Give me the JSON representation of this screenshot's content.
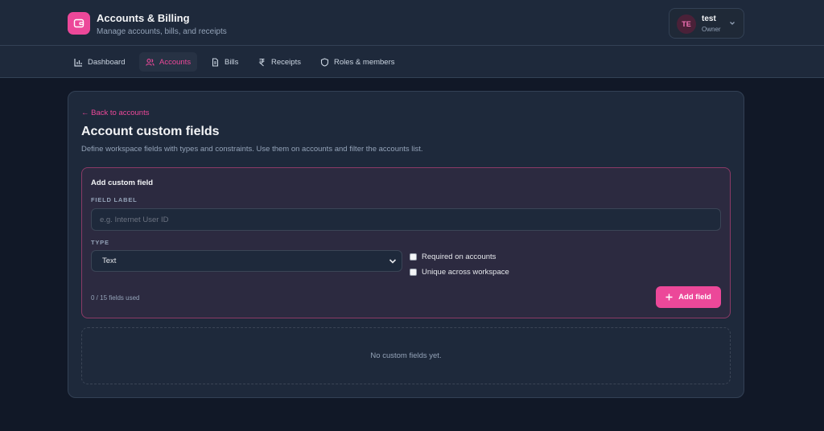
{
  "app": {
    "title": "Accounts & Billing",
    "subtitle": "Manage accounts, bills, and receipts",
    "icon": "wallet-icon",
    "accent": "#ec4899"
  },
  "user": {
    "initials": "TE",
    "name": "test",
    "role": "Owner"
  },
  "nav": {
    "items": [
      {
        "label": "Dashboard",
        "icon": "bar-chart-icon",
        "active": false
      },
      {
        "label": "Accounts",
        "icon": "users-icon",
        "active": true
      },
      {
        "label": "Bills",
        "icon": "document-icon",
        "active": false
      },
      {
        "label": "Receipts",
        "icon": "rupee-icon",
        "active": false
      },
      {
        "label": "Roles & members",
        "icon": "shield-icon",
        "active": false
      }
    ]
  },
  "page": {
    "back_link": "← Back to accounts",
    "title": "Account custom fields",
    "description": "Define workspace fields with types and constraints. Use them on accounts and filter the accounts list."
  },
  "form": {
    "panel_title": "Add custom field",
    "field_label_caption": "FIELD LABEL",
    "field_label_value": "",
    "field_label_placeholder": "e.g. Internet User ID",
    "type_caption": "TYPE",
    "type_selected": "Text",
    "required_label": "Required on accounts",
    "required_checked": false,
    "unique_label": "Unique across workspace",
    "unique_checked": false,
    "usage": "0 / 15 fields used",
    "add_button": "Add field"
  },
  "empty_state": "No custom fields yet."
}
